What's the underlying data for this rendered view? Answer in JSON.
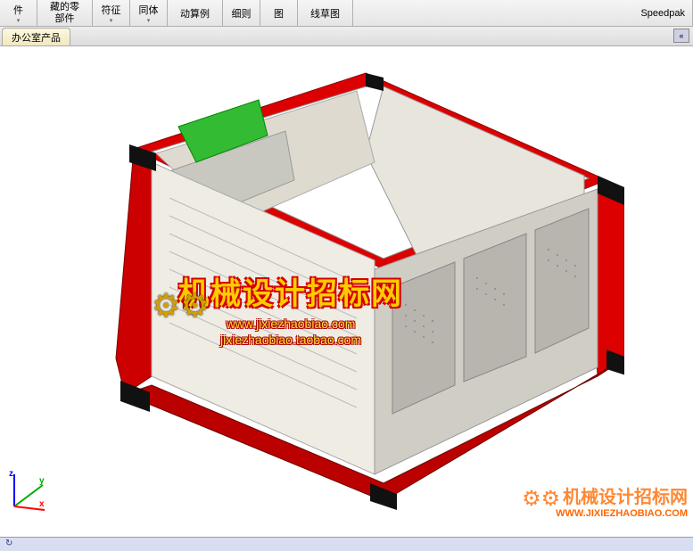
{
  "ribbon": {
    "btn_jian": "件",
    "btn_hidden_parts": "藏的零\n部件",
    "btn_fuzheng": "符征",
    "btn_tongti": "同体",
    "btn_yunsuanli": "动算例",
    "btn_detail": "细则",
    "btn_tu": "图",
    "btn_sketch": "线草图",
    "btn_speedpak": "Speedpak"
  },
  "tabs": {
    "active": "办公室产品"
  },
  "toolbar_icons": {
    "zoom_fit": "zoom-fit",
    "zoom_area": "zoom-area",
    "section": "section-view",
    "display_style": "display-style",
    "hide_show": "hide-show",
    "scene": "edit-scene",
    "appearance": "appearance",
    "settings": "view-settings",
    "capture": "capture"
  },
  "tab_bar": {
    "collapse": "«"
  },
  "triad": {
    "x": "x",
    "y": "y",
    "z": "z"
  },
  "watermark": {
    "title": "机械设计招标网",
    "url1": "www.jixiezhaobiao.com",
    "url2": "jixiezhaobiao.taobao.com",
    "corner_title": "机械设计招标网",
    "corner_url": "WWW.JIXIEZHAOBIAO.COM"
  },
  "status": {
    "refresh": "↻"
  }
}
